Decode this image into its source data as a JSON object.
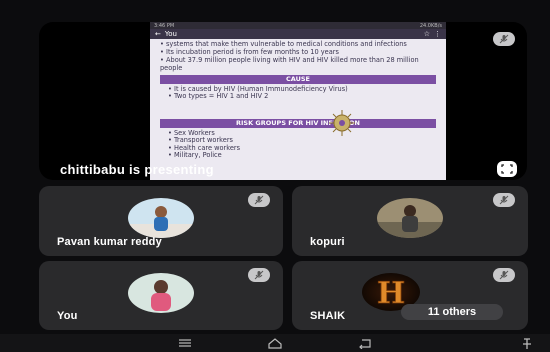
{
  "stage": {
    "presenter_text": "chittibabu is presenting",
    "icons": {
      "mic": "mic-off-icon",
      "fullscreen": "fullscreen-icon"
    }
  },
  "shared_screen": {
    "status_time": "3:46 PM",
    "status_right": "24.0KB/s",
    "doc_title": "You",
    "bullets_top": [
      "systems that make them vulnerable to medical conditions and infections",
      "Its incubation period is from few months to 10 years",
      "About 37.9 million people living with HIV and HIV killed more than 28 million people"
    ],
    "cause_header": "CAUSE",
    "cause_items": [
      "It is caused by HIV (Human Immunodeficiency Virus)",
      "Two types = HIV 1 and HIV 2"
    ],
    "risk_header": "RISK GROUPS FOR HIV INFECTION",
    "risk_items": [
      "Sex Workers",
      "Transport workers",
      "Health care workers",
      "Military, Police"
    ]
  },
  "participants": [
    {
      "name": "Pavan kumar reddy",
      "muted": true
    },
    {
      "name": "kopuri",
      "muted": true
    },
    {
      "name": "You",
      "muted": true
    },
    {
      "name": "SHAIK",
      "muted": true
    }
  ],
  "others_label": "11 others",
  "avatar_letter": "H",
  "navbar": {
    "icons": [
      "recent-apps-icon",
      "home-icon",
      "back-icon",
      "pin-icon"
    ]
  },
  "colors": {
    "background": "#0c0c0e",
    "tile": "#2a2a2c",
    "doc_accent": "#7b4fa3",
    "mic_badge": "#c7c7c9"
  }
}
